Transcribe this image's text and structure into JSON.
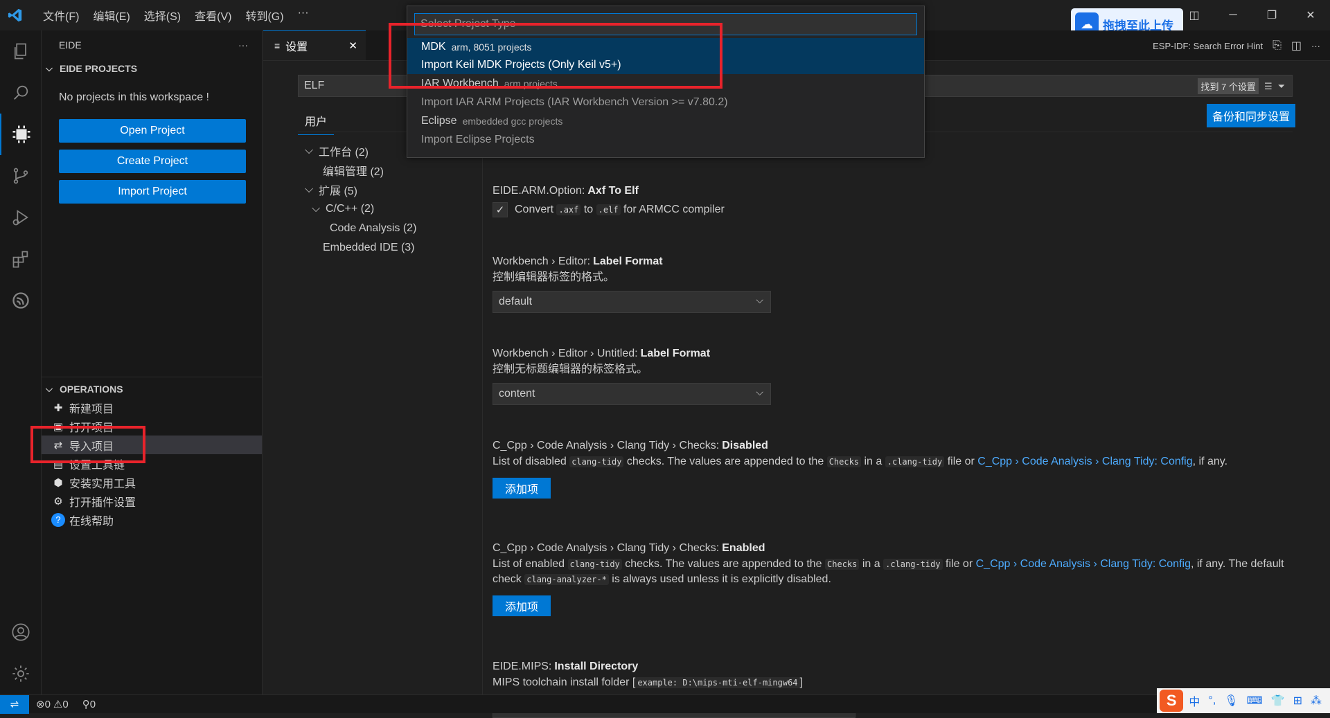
{
  "titlebar": {
    "menus": [
      "文件(F)",
      "编辑(E)",
      "选择(S)",
      "查看(V)",
      "转到(G)",
      "···"
    ],
    "upload_badge": "拖拽至此上传"
  },
  "sidebar": {
    "header": "EIDE",
    "projects_section": "EIDE PROJECTS",
    "empty_message": "No projects in this workspace !",
    "buttons": [
      "Open Project",
      "Create Project",
      "Import Project"
    ],
    "operations_section": "OPERATIONS",
    "operations": [
      "新建项目",
      "打开项目",
      "导入项目",
      "设置工具链",
      "安装实用工具",
      "打开插件设置",
      "在线帮助"
    ]
  },
  "editor": {
    "tab_title": "设置",
    "right_title": "ESP-IDF: Search Error Hint",
    "search_value": "ELF",
    "result_count": "找到 7 个设置",
    "scope_tab": "用户",
    "sync_button": "备份和同步设置",
    "toc": [
      "工作台 (2)",
      "编辑管理 (2)",
      "扩展 (5)",
      "C/C++ (2)",
      "Code Analysis (2)",
      "Embedded IDE (3)"
    ]
  },
  "settings": {
    "axf": {
      "prefix": "EIDE.ARM.Option:",
      "name": "Axf To Elf",
      "label_a": "Convert",
      "code_a": ".axf",
      "label_b": "to",
      "code_b": ".elf",
      "label_c": "for ARMCC compiler"
    },
    "label_format": {
      "prefix": "Workbench › Editor:",
      "name": "Label Format",
      "desc": "控制编辑器标签的格式。",
      "value": "default"
    },
    "untitled_label": {
      "prefix": "Workbench › Editor › Untitled:",
      "name": "Label Format",
      "desc": "控制无标题编辑器的标签格式。",
      "value": "content"
    },
    "clang_disabled": {
      "prefix": "C_Cpp › Code Analysis › Clang Tidy › Checks:",
      "name": "Disabled",
      "d1": "List of disabled",
      "c1": "clang-tidy",
      "d2": "checks. The values are appended to the",
      "c2": "Checks",
      "d3": "in a",
      "c3": ".clang-tidy",
      "d4": "file or",
      "link": "C_Cpp › Code Analysis › Clang Tidy: Config",
      "d5": ", if any.",
      "button": "添加项"
    },
    "clang_enabled": {
      "prefix": "C_Cpp › Code Analysis › Clang Tidy › Checks:",
      "name": "Enabled",
      "d1": "List of enabled",
      "c1": "clang-tidy",
      "d2": "checks. The values are appended to the",
      "c2": "Checks",
      "d3": "in a",
      "c3": ".clang-tidy",
      "d4": "file or",
      "link": "C_Cpp › Code Analysis › Clang Tidy: Config",
      "d5": ", if any. The default check",
      "c4": "clang-analyzer-*",
      "d6": "is always used unless it is explicitly disabled.",
      "button": "添加项"
    },
    "mips": {
      "prefix": "EIDE.MIPS:",
      "name": "Install Directory",
      "desc": "MIPS toolchain install folder",
      "code": "example: D:\\mips-mti-elf-mingw64"
    }
  },
  "quickpick": {
    "placeholder": "Select Project Type",
    "items": [
      {
        "label": "MDK",
        "desc": "arm, 8051 projects"
      },
      {
        "label": "Import Keil MDK Projects (Only Keil v5+)",
        "desc": ""
      },
      {
        "label": "IAR Workbench",
        "desc": "arm projects"
      },
      {
        "label": "Import IAR ARM Projects (IAR Workbench Version >= v7.80.2)",
        "desc": ""
      },
      {
        "label": "Eclipse",
        "desc": "embedded gcc projects"
      },
      {
        "label": "Import Eclipse Projects",
        "desc": ""
      }
    ]
  },
  "statusbar": {
    "errors": "0",
    "warnings": "0",
    "ports": "0"
  },
  "ime": {
    "lang": "中"
  }
}
